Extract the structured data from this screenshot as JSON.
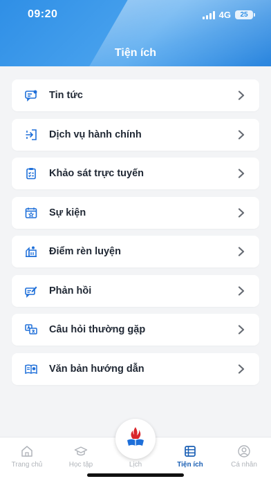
{
  "status_bar": {
    "time": "09:20",
    "network": "4G",
    "battery": "25"
  },
  "header": {
    "title": "Tiện ích"
  },
  "menu": [
    {
      "label": "Tin tức",
      "icon": "news-icon"
    },
    {
      "label": "Dịch vụ hành chính",
      "icon": "admin-services-icon"
    },
    {
      "label": "Khảo sát trực tuyến",
      "icon": "survey-clipboard-icon"
    },
    {
      "label": "Sự kiện",
      "icon": "calendar-event-icon"
    },
    {
      "label": "Điểm rèn luyện",
      "icon": "training-score-icon"
    },
    {
      "label": "Phản hồi",
      "icon": "feedback-icon"
    },
    {
      "label": "Câu hỏi thường gặp",
      "icon": "faq-icon"
    },
    {
      "label": "Văn bản hướng dẫn",
      "icon": "guide-document-icon"
    }
  ],
  "tabbar": {
    "tabs": [
      {
        "label": "Trang chủ",
        "icon": "home-icon"
      },
      {
        "label": "Học tập",
        "icon": "graduation-cap-icon"
      },
      {
        "label": "Lịch",
        "icon": "calendar-icon"
      },
      {
        "label": "Tiện ích",
        "icon": "utilities-icon",
        "active": true
      },
      {
        "label": "Cá nhân",
        "icon": "profile-icon"
      }
    ],
    "center_logo": "app-logo"
  },
  "colors": {
    "primary": "#2f8fe6",
    "active_tab": "#1a5fb4",
    "icon_blue": "#1e6fd9",
    "text": "#1f2733"
  }
}
